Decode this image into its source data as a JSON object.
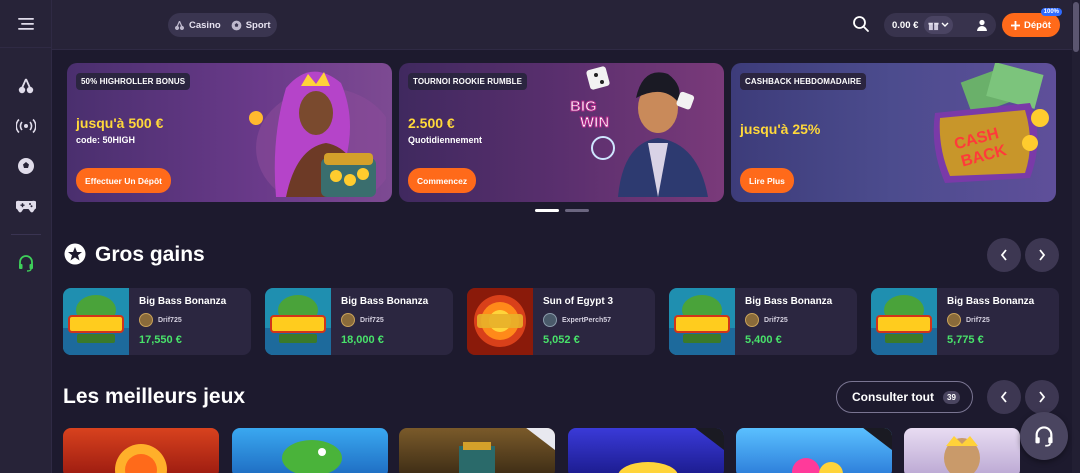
{
  "header": {
    "tabs": [
      {
        "label": "Casino",
        "icon": "cherries-icon"
      },
      {
        "label": "Sport",
        "icon": "soccer-ball-icon"
      }
    ],
    "balance": "0.00 €",
    "deposit_label": "Dépôt",
    "deposit_badge": "100%"
  },
  "sidebar": {
    "items": [
      {
        "icon": "cherries-icon"
      },
      {
        "icon": "live-broadcast-icon"
      },
      {
        "icon": "soccer-ball-icon"
      },
      {
        "icon": "gamepad-icon"
      },
      {
        "icon": "headset-icon"
      }
    ]
  },
  "banners": [
    {
      "tag": "50% HIGHROLLER BONUS",
      "headline": "jusqu'à 500 €",
      "sub": "code: 50HIGH",
      "button": "Effectuer Un Dépôt"
    },
    {
      "tag": "TOURNOI ROOKIE RUMBLE",
      "headline": "2.500 €",
      "sub": "Quotidiennement",
      "button": "Commencez",
      "art_text_1": "BIG",
      "art_text_2": "WIN"
    },
    {
      "tag": "CASHBACK HEBDOMADAIRE",
      "headline": "jusqu'à 25%",
      "sub": "",
      "button": "Lire Plus",
      "art_text_1": "CASH",
      "art_text_2": "BACK"
    }
  ],
  "big_wins": {
    "title": "Gros gains",
    "cards": [
      {
        "game": "Big Bass Bonanza",
        "user": "Drif725",
        "amount": "17,550 €",
        "thumb": "bigbass"
      },
      {
        "game": "Big Bass Bonanza",
        "user": "Drif725",
        "amount": "18,000 €",
        "thumb": "bigbass"
      },
      {
        "game": "Sun of Egypt 3",
        "user": "ExpertPerch57",
        "amount": "5,052 €",
        "thumb": "egypt"
      },
      {
        "game": "Big Bass Bonanza",
        "user": "Drif725",
        "amount": "5,400 €",
        "thumb": "bigbass"
      },
      {
        "game": "Big Bass Bonanza",
        "user": "Drif725",
        "amount": "5,775 €",
        "thumb": "bigbass"
      }
    ]
  },
  "top_games": {
    "title": "Les meilleurs jeux",
    "view_all": "Consulter tout",
    "count": "39",
    "tiles": [
      {
        "bg": "#c8321e",
        "corner": false
      },
      {
        "bg": "#2a8fd8",
        "corner": false
      },
      {
        "bg": "#6a4a22",
        "corner": true,
        "dark": false
      },
      {
        "bg": "#2c2fb0",
        "corner": true,
        "dark": true
      },
      {
        "bg": "#3a9cf0",
        "corner": true,
        "dark": true
      },
      {
        "bg": "#d9c7e8",
        "corner": false
      }
    ]
  },
  "colors": {
    "accent": "#ff6a1a",
    "win_green": "#48e26a",
    "gold": "#ffd83a"
  }
}
